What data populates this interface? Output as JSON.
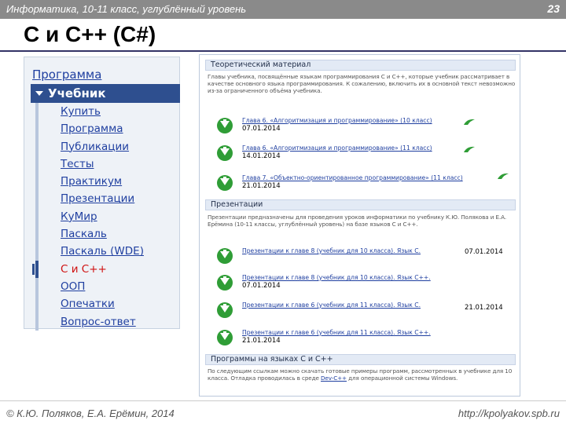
{
  "header": {
    "subject": "Информатика, 10-11 класс, углублённый уровень",
    "page_number": "23"
  },
  "slide": {
    "title": "С и С++ (C#)"
  },
  "sidebar": {
    "top_link": "Программа",
    "active_section": "Учебник",
    "items": [
      {
        "label": "Купить"
      },
      {
        "label": "Программа"
      },
      {
        "label": "Публикации"
      },
      {
        "label": "Тесты"
      },
      {
        "label": "Практикум"
      },
      {
        "label": "Презентации"
      },
      {
        "label": "КуМир"
      },
      {
        "label": "Паскаль"
      },
      {
        "label": "Паскаль (WDE)"
      },
      {
        "label": "С и С++"
      },
      {
        "label": "ООП"
      },
      {
        "label": "Опечатки"
      },
      {
        "label": "Вопрос-ответ"
      }
    ],
    "current_item": "С и С++"
  },
  "content": {
    "sections": [
      {
        "heading": "Теоретический материал",
        "text": "Главы учебника, посвящённые языкам программирования С и С++, которые учебник рассматривает в качестве основного языка программирования. К сожалению, включить их в основной текст невозможно из-за ограниченного объёма учебника.",
        "files": [
          {
            "title": "Глава 6. «Алгоритмизация и программирование» (10 класс)",
            "date": "07.01.2014"
          },
          {
            "title": "Глава 6. «Алгоритмизация и программирование» (11 класс)",
            "date": "14.01.2014"
          },
          {
            "title": "Глава 7. «Объектно-ориентированное программирование» (11 класс)",
            "date": "21.01.2014"
          }
        ]
      },
      {
        "heading": "Презентации",
        "text": "Презентации предназначены для проведения уроков информатики по учебнику К.Ю. Полякова и Е.А. Ерёмина (10-11 классы, углублённый уровень) на базе языков С и С++.",
        "files": [
          {
            "title": "Презентации к главе 8 (учебник для 10 класса). Язык С.",
            "date": "07.01.2014"
          },
          {
            "title": "Презентации к главе 8 (учебник для 10 класса). Язык С++.",
            "date": "07.01.2014"
          },
          {
            "title": "Презентации к главе 6 (учебник для 11 класса). Язык С.",
            "date": "21.01.2014"
          },
          {
            "title": "Презентации к главе 6 (учебник для 11 класса). Язык С++.",
            "date": "21.01.2014"
          }
        ]
      },
      {
        "heading": "Программы на языках С и С++",
        "text_before_link": "По следующим ссылкам можно скачать готовые примеры программ, рассмотренных в учебнике для 10 класса. Отладка проводилась в среде ",
        "link": "Dev-C++",
        "text_after_link": " для операционной системы Windows."
      }
    ]
  },
  "footer": {
    "authors": "© К.Ю. Поляков, Е.А. Ерёмин, 2014",
    "url": "http://kpolyakov.spb.ru"
  },
  "colors": {
    "topbar": "#8a8a8a",
    "sidebar_active": "#2e4f8f",
    "link": "#1f3fa0",
    "current": "#d01010",
    "download_icon": "#2f9d36"
  }
}
